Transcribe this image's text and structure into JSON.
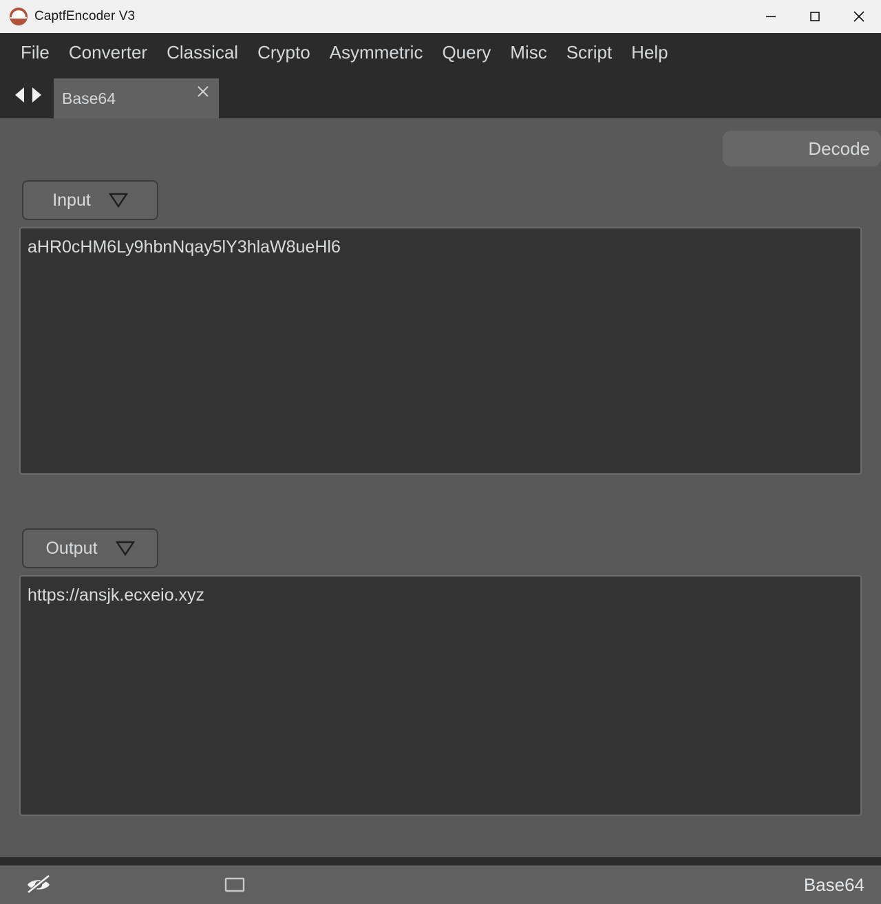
{
  "window": {
    "title": "CaptfEncoder V3",
    "logo_icon": "captf-logo-icon",
    "controls": {
      "minimize": "minimize-icon",
      "maximize": "maximize-icon",
      "close": "close-icon"
    }
  },
  "menubar": {
    "items": [
      {
        "label": "File"
      },
      {
        "label": "Converter"
      },
      {
        "label": "Classical"
      },
      {
        "label": "Crypto"
      },
      {
        "label": "Asymmetric"
      },
      {
        "label": "Query"
      },
      {
        "label": "Misc"
      },
      {
        "label": "Script"
      },
      {
        "label": "Help"
      }
    ]
  },
  "tabbar": {
    "prev_icon": "arrow-left-icon",
    "next_icon": "arrow-right-icon",
    "tabs": [
      {
        "label": "Base64",
        "active": true,
        "close_icon": "close-icon"
      }
    ]
  },
  "main": {
    "action_button": {
      "label": "Decode"
    },
    "input": {
      "section_label": "Input",
      "dropdown_icon": "chevron-down-icon",
      "value": "aHR0cHM6Ly9hbnNqay5lY3hlaW8ueHl6",
      "placeholder": ""
    },
    "output": {
      "section_label": "Output",
      "dropdown_icon": "chevron-down-icon",
      "value": "https://ansjk.ecxeio.xyz",
      "placeholder": ""
    }
  },
  "statusbar": {
    "visibility_icon": "eye-slash-icon",
    "window_icon": "window-icon",
    "mode_label": "Base64"
  },
  "colors": {
    "titlebar_bg": "#f0f0f0",
    "menubar_bg": "#2b2b2b",
    "content_bg": "#595959",
    "textbox_bg": "#333333",
    "text": "#d7dadd",
    "accent": "#b0553c"
  }
}
